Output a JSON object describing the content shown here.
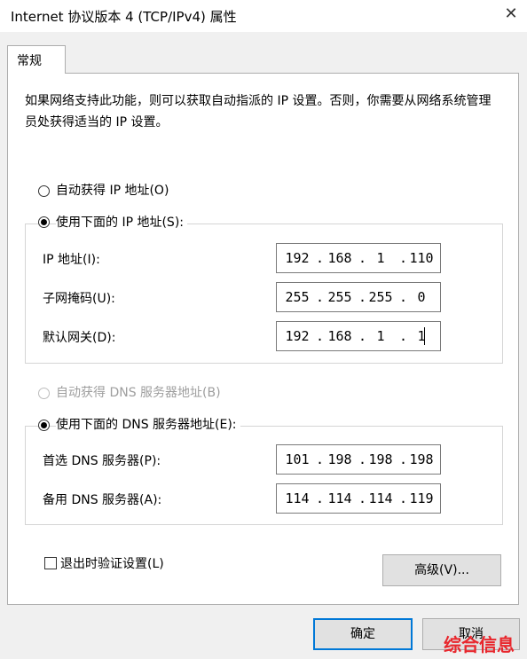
{
  "window": {
    "title": "Internet 协议版本 4 (TCP/IPv4) 属性",
    "close_symbol": "✕"
  },
  "tabs": [
    {
      "label": "常规"
    }
  ],
  "description": "如果网络支持此功能，则可以获取自动指派的 IP 设置。否则，你需要从网络系统管理员处获得适当的 IP 设置。",
  "ip": {
    "auto_label": "自动获得 IP 地址(O)",
    "manual_label": "使用下面的 IP 地址(S):",
    "selected": "manual",
    "fields": [
      {
        "label": "IP 地址(I):",
        "octets": [
          "192",
          "168",
          "1",
          "110"
        ]
      },
      {
        "label": "子网掩码(U):",
        "octets": [
          "255",
          "255",
          "255",
          "0"
        ]
      },
      {
        "label": "默认网关(D):",
        "octets": [
          "192",
          "168",
          "1",
          "1"
        ]
      }
    ]
  },
  "dns": {
    "auto_label": "自动获得 DNS 服务器地址(B)",
    "manual_label": "使用下面的 DNS 服务器地址(E):",
    "selected": "manual",
    "auto_disabled": true,
    "fields": [
      {
        "label": "首选 DNS 服务器(P):",
        "octets": [
          "101",
          "198",
          "198",
          "198"
        ]
      },
      {
        "label": "备用 DNS 服务器(A):",
        "octets": [
          "114",
          "114",
          "114",
          "119"
        ]
      }
    ]
  },
  "validate": {
    "label": "退出时验证设置(L)",
    "checked": false
  },
  "buttons": {
    "advanced": "高级(V)...",
    "ok": "确定",
    "cancel": "取消"
  },
  "watermark": "综合信息"
}
